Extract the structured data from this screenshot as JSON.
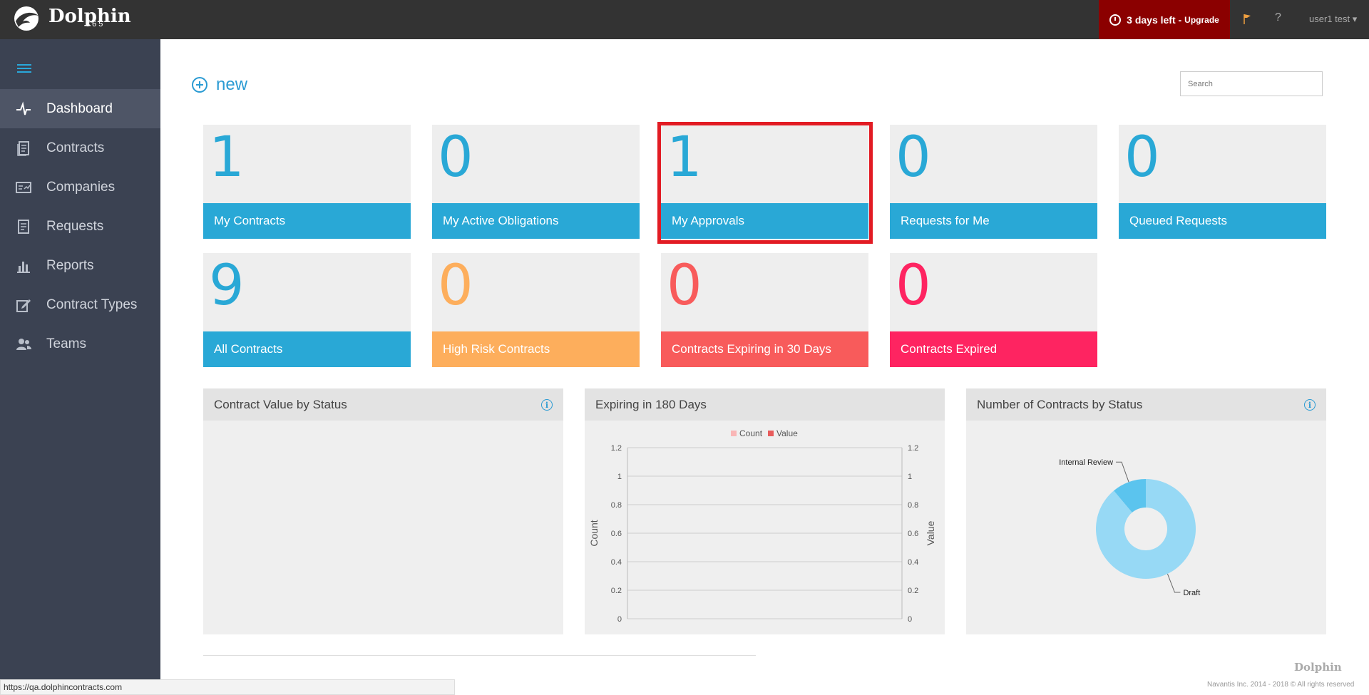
{
  "header": {
    "brand": "Dolphin",
    "brand_sub": "365",
    "trial_text": "3 days left -",
    "upgrade_label": "Upgrade",
    "help": "?",
    "user": "user1 test ▾"
  },
  "sidebar": {
    "items": [
      {
        "label": "Dashboard"
      },
      {
        "label": "Contracts"
      },
      {
        "label": "Companies"
      },
      {
        "label": "Requests"
      },
      {
        "label": "Reports"
      },
      {
        "label": "Contract Types"
      },
      {
        "label": "Teams"
      }
    ]
  },
  "main": {
    "new_label": "new",
    "search_placeholder": "Search",
    "tiles": [
      {
        "value": "1",
        "label": "My Contracts",
        "color": "#29a8d6"
      },
      {
        "value": "0",
        "label": "My Active Obligations",
        "color": "#29a8d6"
      },
      {
        "value": "1",
        "label": "My Approvals",
        "color": "#29a8d6"
      },
      {
        "value": "0",
        "label": "Requests for Me",
        "color": "#29a8d6"
      },
      {
        "value": "0",
        "label": "Queued Requests",
        "color": "#29a8d6"
      },
      {
        "value": "9",
        "label": "All Contracts",
        "color": "#29a8d6"
      },
      {
        "value": "0",
        "label": "High Risk Contracts",
        "color": "#fdae5c"
      },
      {
        "value": "0",
        "label": "Contracts Expiring in 30 Days",
        "color": "#f85b5b"
      },
      {
        "value": "0",
        "label": "Contracts Expired",
        "color": "#fe2461"
      }
    ],
    "panels": {
      "value_by_status": {
        "title": "Contract Value by Status"
      },
      "expiring": {
        "title": "Expiring in 180 Days"
      },
      "by_status": {
        "title": "Number of Contracts by Status"
      }
    }
  },
  "chart_data": [
    {
      "type": "line",
      "title": "Expiring in 180 Days",
      "series": [
        {
          "name": "Count",
          "values": [],
          "color": "#f9b6b6"
        },
        {
          "name": "Value",
          "values": [],
          "color": "#e85c5c"
        }
      ],
      "ylabel": "Count",
      "y2label": "Value",
      "ylim": [
        0,
        1.2
      ],
      "y2lim": [
        0,
        1.2
      ],
      "yticks": [
        "0",
        "0.2",
        "0.4",
        "0.6",
        "0.8",
        "1",
        "1.2"
      ],
      "legend": "top",
      "grid": true
    },
    {
      "type": "pie",
      "title": "Number of Contracts by Status",
      "categories": [
        "Internal Review",
        "Draft"
      ],
      "values": [
        1,
        8
      ],
      "colors": [
        "#5bc4ee",
        "#97d9f5"
      ]
    }
  ],
  "footer": {
    "brand": "Dolphin",
    "copyright": "Navantis Inc. 2014 - 2018 © All rights reserved",
    "status_url": "https://qa.dolphincontracts.com"
  }
}
